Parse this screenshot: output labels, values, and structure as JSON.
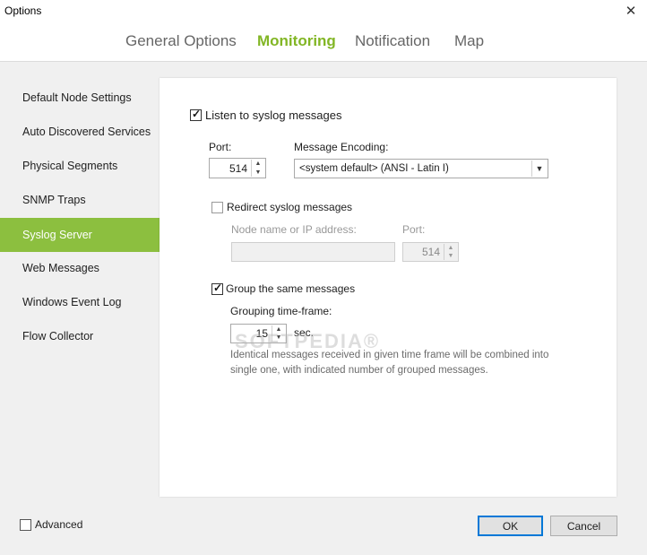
{
  "window": {
    "title": "Options"
  },
  "tabs": [
    "General Options",
    "Monitoring",
    "Notification",
    "Map"
  ],
  "sidebar": {
    "items": [
      "Default Node Settings",
      "Auto Discovered Services",
      "Physical Segments",
      "SNMP Traps",
      "Syslog Server",
      "Web Messages",
      "Windows Event Log",
      "Flow Collector"
    ],
    "active": "Syslog Server"
  },
  "syslog": {
    "listen_label": "Listen to syslog messages",
    "port_label": "Port:",
    "port_value": "514",
    "encoding_label": "Message Encoding:",
    "encoding_value": "<system default> (ANSI - Latin I)",
    "redirect_label": "Redirect syslog messages",
    "node_label": "Node name or IP address:",
    "node_value": "",
    "redirect_port_label": "Port:",
    "redirect_port_value": "514",
    "group_label": "Group the same messages",
    "timeframe_label": "Grouping time-frame:",
    "timeframe_value": "15",
    "timeframe_unit": "sec.",
    "hint": "Identical messages received in given time frame will be combined into single one, with indicated number of grouped messages.",
    "watermark": "SOFTPEDIA®"
  },
  "footer": {
    "advanced_label": "Advanced",
    "ok_label": "OK",
    "cancel_label": "Cancel"
  },
  "colors": {
    "accent": "#82b625",
    "sidebar_active": "#8cbf3f"
  }
}
